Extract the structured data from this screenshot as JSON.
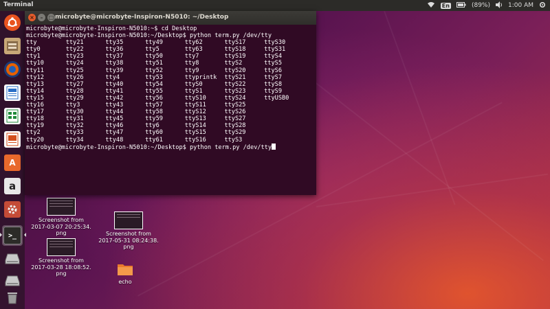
{
  "topbar": {
    "title": "Terminal",
    "keyboard_layout": "En",
    "battery": "(89%)",
    "time": "1:00 AM"
  },
  "launcher": {
    "items": [
      {
        "name": "ubuntu-dash",
        "label": "",
        "icon": "ubuntu-logo-icon",
        "color": "#e95420"
      },
      {
        "name": "files",
        "label": "",
        "icon": "files-icon",
        "color": "#c8a878"
      },
      {
        "name": "firefox",
        "label": "",
        "icon": "firefox-icon",
        "color": "#e66000"
      },
      {
        "name": "libreoffice-writer",
        "label": "",
        "icon": "writer-icon",
        "color": "#2a6fc7"
      },
      {
        "name": "libreoffice-calc",
        "label": "",
        "icon": "calc-icon",
        "color": "#1f8a3a"
      },
      {
        "name": "libreoffice-impress",
        "label": "",
        "icon": "impress-icon",
        "color": "#d24d1c"
      },
      {
        "name": "software-center",
        "label": "A",
        "icon": "software-center-icon",
        "color": "#e9692c"
      },
      {
        "name": "amazon",
        "label": "a",
        "icon": "amazon-icon",
        "color": "#e8e8e8"
      },
      {
        "name": "system-settings",
        "label": "",
        "icon": "settings-icon",
        "color": "#c44b37"
      },
      {
        "name": "terminal",
        "label": ">_",
        "icon": "terminal-icon",
        "color": "#2c2b28"
      },
      {
        "name": "drive-1",
        "label": "",
        "icon": "drive-icon",
        "color": "#bbbbbb"
      },
      {
        "name": "drive-2",
        "label": "",
        "icon": "drive-icon",
        "color": "#bbbbbb"
      },
      {
        "name": "trash",
        "label": "",
        "icon": "trash-icon",
        "color": "#999999"
      }
    ]
  },
  "terminal": {
    "window_title": "microbyte@microbyte-Inspiron-N5010: ~/Desktop",
    "line1": "microbyte@microbyte-Inspiron-N5010:~$ cd Desktop",
    "line2": "microbyte@microbyte-Inspiron-N5010:~/Desktop$ python term.py /dev/tty",
    "columns": [
      [
        "tty",
        "tty0",
        "tty1",
        "tty10",
        "tty11",
        "tty12",
        "tty13",
        "tty14",
        "tty15",
        "tty16",
        "tty17",
        "tty18",
        "tty19",
        "tty2",
        "tty20"
      ],
      [
        "tty21",
        "tty22",
        "tty23",
        "tty24",
        "tty25",
        "tty26",
        "tty27",
        "tty28",
        "tty29",
        "tty3",
        "tty30",
        "tty31",
        "tty32",
        "tty33",
        "tty34"
      ],
      [
        "tty35",
        "tty36",
        "tty37",
        "tty38",
        "tty39",
        "tty4",
        "tty40",
        "tty41",
        "tty42",
        "tty43",
        "tty44",
        "tty45",
        "tty46",
        "tty47",
        "tty48"
      ],
      [
        "tty49",
        "tty5",
        "tty50",
        "tty51",
        "tty52",
        "tty53",
        "tty54",
        "tty55",
        "tty56",
        "tty57",
        "tty58",
        "tty59",
        "tty6",
        "tty60",
        "tty61"
      ],
      [
        "tty62",
        "tty63",
        "tty7",
        "tty8",
        "tty9",
        "ttyprintk",
        "ttyS0",
        "ttyS1",
        "ttyS10",
        "ttyS11",
        "ttyS12",
        "ttyS13",
        "ttyS14",
        "ttyS15",
        "ttyS16"
      ],
      [
        "ttyS17",
        "ttyS18",
        "ttyS19",
        "ttyS2",
        "ttyS20",
        "ttyS21",
        "ttyS22",
        "ttyS23",
        "ttyS24",
        "ttyS25",
        "ttyS26",
        "ttyS27",
        "ttyS28",
        "ttyS29",
        "ttyS3"
      ],
      [
        "ttyS30",
        "ttyS31",
        "ttyS4",
        "ttyS5",
        "ttyS6",
        "ttyS7",
        "ttyS8",
        "ttyS9",
        "ttyUSB0",
        "",
        "",
        "",
        "",
        "",
        ""
      ]
    ],
    "last_line": "microbyte@microbyte-Inspiron-N5010:~/Desktop$ python term.py /dev/tty"
  },
  "desktop": {
    "icons": [
      {
        "label1": "Screenshot from",
        "label2": "2017-03-07 20:25:34.",
        "label3": "png"
      },
      {
        "label1": "Screenshot from",
        "label2": "2017-03-28 18:08:52.",
        "label3": "png"
      },
      {
        "label1": "Screenshot from",
        "label2": "2017-05-31 08:24:38.",
        "label3": "png"
      },
      {
        "label1": "echo",
        "label2": "",
        "label3": ""
      }
    ]
  }
}
